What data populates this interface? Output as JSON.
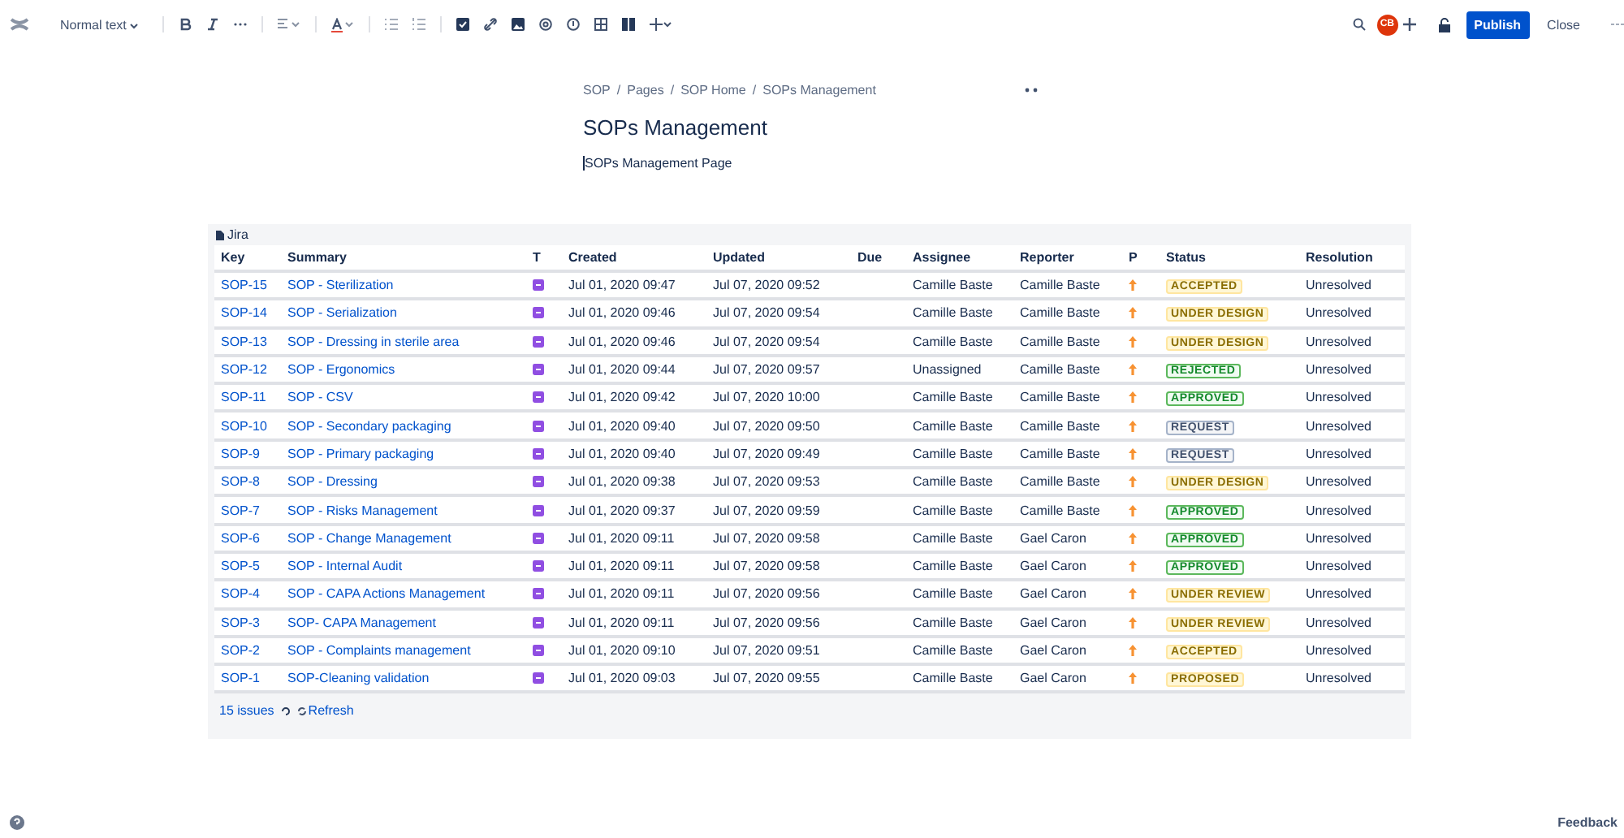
{
  "toolbar": {
    "text_style": "Normal text",
    "publish": "Publish",
    "close": "Close",
    "avatar": "CB"
  },
  "breadcrumbs": [
    "SOP",
    "Pages",
    "SOP Home",
    "SOPs Management"
  ],
  "breadcrumb_separator": "/",
  "page": {
    "title": "SOPs Management",
    "body": "SOPs Management Page"
  },
  "jira": {
    "label": "Jira",
    "columns": [
      "Key",
      "Summary",
      "T",
      "Created",
      "Updated",
      "Due",
      "Assignee",
      "Reporter",
      "P",
      "Status",
      "Resolution"
    ],
    "rows": [
      {
        "key": "SOP-15",
        "summary": "SOP - Sterilization",
        "created": "Jul 01, 2020 09:47",
        "updated": "Jul 07, 2020 09:52",
        "assignee": "Camille Baste",
        "reporter": "Camille Baste",
        "status": "ACCEPTED",
        "color": "#8a6d00",
        "resolution": "Unresolved"
      },
      {
        "key": "SOP-14",
        "summary": "SOP - Serialization",
        "created": "Jul 01, 2020 09:46",
        "updated": "Jul 07, 2020 09:54",
        "assignee": "Camille Baste",
        "reporter": "Camille Baste",
        "status": "UNDER DESIGN",
        "color": "#8a6d00",
        "resolution": "Unresolved"
      },
      {
        "key": "SOP-13",
        "summary": "SOP - Dressing in sterile area",
        "created": "Jul 01, 2020 09:46",
        "updated": "Jul 07, 2020 09:54",
        "assignee": "Camille Baste",
        "reporter": "Camille Baste",
        "status": "UNDER DESIGN",
        "color": "#8a6d00",
        "resolution": "Unresolved"
      },
      {
        "key": "SOP-12",
        "summary": "SOP - Ergonomics",
        "created": "Jul 01, 2020 09:44",
        "updated": "Jul 07, 2020 09:57",
        "assignee": "Unassigned",
        "reporter": "Camille Baste",
        "status": "REJECTED",
        "color": "#14892c",
        "resolution": "Unresolved"
      },
      {
        "key": "SOP-11",
        "summary": "SOP - CSV",
        "created": "Jul 01, 2020 09:42",
        "updated": "Jul 07, 2020 10:00",
        "assignee": "Camille Baste",
        "reporter": "Camille Baste",
        "status": "APPROVED",
        "color": "#14892c",
        "resolution": "Unresolved"
      },
      {
        "key": "SOP-10",
        "summary": "SOP - Secondary packaging",
        "created": "Jul 01, 2020 09:40",
        "updated": "Jul 07, 2020 09:50",
        "assignee": "Camille Baste",
        "reporter": "Camille Baste",
        "status": "REQUEST",
        "color": "#42526e",
        "resolution": "Unresolved"
      },
      {
        "key": "SOP-9",
        "summary": "SOP - Primary packaging",
        "created": "Jul 01, 2020 09:40",
        "updated": "Jul 07, 2020 09:49",
        "assignee": "Camille Baste",
        "reporter": "Camille Baste",
        "status": "REQUEST",
        "color": "#42526e",
        "resolution": "Unresolved"
      },
      {
        "key": "SOP-8",
        "summary": "SOP - Dressing",
        "created": "Jul 01, 2020 09:38",
        "updated": "Jul 07, 2020 09:53",
        "assignee": "Camille Baste",
        "reporter": "Camille Baste",
        "status": "UNDER DESIGN",
        "color": "#8a6d00",
        "resolution": "Unresolved"
      },
      {
        "key": "SOP-7",
        "summary": "SOP - Risks Management",
        "created": "Jul 01, 2020 09:37",
        "updated": "Jul 07, 2020 09:59",
        "assignee": "Camille Baste",
        "reporter": "Camille Baste",
        "status": "APPROVED",
        "color": "#14892c",
        "resolution": "Unresolved"
      },
      {
        "key": "SOP-6",
        "summary": "SOP - Change Management",
        "created": "Jul 01, 2020 09:11",
        "updated": "Jul 07, 2020 09:58",
        "assignee": "Camille Baste",
        "reporter": "Gael Caron",
        "status": "APPROVED",
        "color": "#14892c",
        "resolution": "Unresolved"
      },
      {
        "key": "SOP-5",
        "summary": "SOP - Internal Audit",
        "created": "Jul 01, 2020 09:11",
        "updated": "Jul 07, 2020 09:58",
        "assignee": "Camille Baste",
        "reporter": "Gael Caron",
        "status": "APPROVED",
        "color": "#14892c",
        "resolution": "Unresolved"
      },
      {
        "key": "SOP-4",
        "summary": "SOP - CAPA Actions Management",
        "created": "Jul 01, 2020 09:11",
        "updated": "Jul 07, 2020 09:56",
        "assignee": "Camille Baste",
        "reporter": "Gael Caron",
        "status": "UNDER REVIEW",
        "color": "#8a6d00",
        "resolution": "Unresolved"
      },
      {
        "key": "SOP-3",
        "summary": "SOP- CAPA Management",
        "created": "Jul 01, 2020 09:11",
        "updated": "Jul 07, 2020 09:56",
        "assignee": "Camille Baste",
        "reporter": "Gael Caron",
        "status": "UNDER REVIEW",
        "color": "#8a6d00",
        "resolution": "Unresolved"
      },
      {
        "key": "SOP-2",
        "summary": "SOP - Complaints management",
        "created": "Jul 01, 2020 09:10",
        "updated": "Jul 07, 2020 09:51",
        "assignee": "Camille Baste",
        "reporter": "Gael Caron",
        "status": "ACCEPTED",
        "color": "#8a6d00",
        "resolution": "Unresolved"
      },
      {
        "key": "SOP-1",
        "summary": "SOP-Cleaning validation",
        "created": "Jul 01, 2020 09:03",
        "updated": "Jul 07, 2020 09:55",
        "assignee": "Camille Baste",
        "reporter": "Gael Caron",
        "status": "PROPOSED",
        "color": "#8a6d00",
        "resolution": "Unresolved"
      }
    ],
    "count": "15 issues",
    "refresh": "Refresh"
  },
  "feedback": "Feedback"
}
